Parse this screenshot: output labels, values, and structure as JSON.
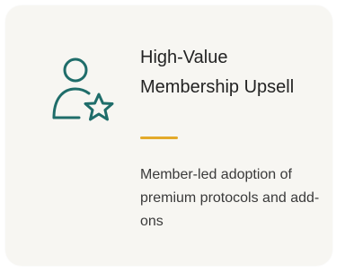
{
  "card": {
    "title": "High-Value Membership Upsell",
    "description": "Member-led adoption of premium protocols and add-ons",
    "icon": "user-star-icon"
  },
  "colors": {
    "card_background": "#f7f6f2",
    "icon_color": "#1f6d6a",
    "accent": "#e3aa2a",
    "title_text": "#232323",
    "body_text": "#3a3a3a"
  }
}
